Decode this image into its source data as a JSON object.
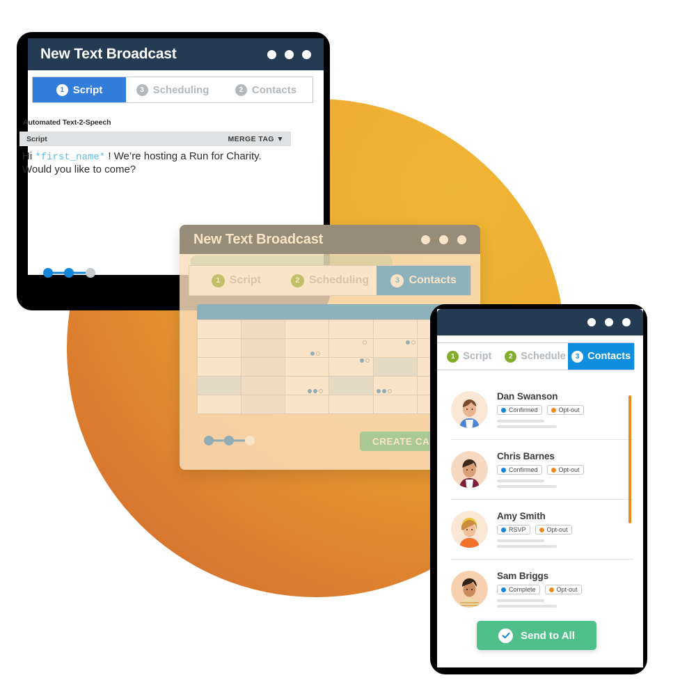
{
  "window1": {
    "title": "New Text Broadcast",
    "tabs": [
      {
        "num": "1",
        "label": "Script",
        "active": true
      },
      {
        "num": "3",
        "label": "Scheduling",
        "active": false
      },
      {
        "num": "2",
        "label": "Contacts",
        "active": false
      }
    ],
    "section_label": "Automated Text-2-Speech",
    "field_label": "Script",
    "merge_tag_label": "MERGE TAG",
    "merge_tag_caret": "▼",
    "script_prefix": "Hi ",
    "script_merge_field": "*first_name*",
    "script_suffix": " ! We’re hosting a Run for Charity. Would you like to come?",
    "steps": [
      "done",
      "done",
      "todo"
    ]
  },
  "window2": {
    "title": "New Text Broadcast",
    "tabs": [
      {
        "num": "1",
        "label": "Script",
        "active": false
      },
      {
        "num": "2",
        "label": "Scheduling",
        "active": false
      },
      {
        "num": "3",
        "label": "Contacts",
        "active": true
      }
    ],
    "primary_button": "CREATE CAMPAIGN",
    "steps": [
      "done",
      "done",
      "todo"
    ],
    "calendar": {
      "rows": 5,
      "cols": 6,
      "shaded_column": 1,
      "selected_cells": [
        [
          2,
          4
        ],
        [
          3,
          0
        ],
        [
          3,
          3
        ]
      ],
      "events": [
        {
          "row": 1,
          "col": 2,
          "filled": 1,
          "open": 1
        },
        {
          "row": 1,
          "col": 3,
          "filled": 0,
          "open": 1
        },
        {
          "row": 1,
          "col": 4,
          "filled": 1,
          "open": 1
        },
        {
          "row": 2,
          "col": 3,
          "filled": 1,
          "open": 1
        },
        {
          "row": 3,
          "col": 2,
          "filled": 2,
          "open": 1
        },
        {
          "row": 3,
          "col": 4,
          "filled": 2,
          "open": 1
        }
      ]
    }
  },
  "window3": {
    "tabs": [
      {
        "num": "1",
        "label": "Script",
        "active": false
      },
      {
        "num": "2",
        "label": "Schedule",
        "active": false
      },
      {
        "num": "3",
        "label": "Contacts",
        "active": true
      }
    ],
    "contacts": [
      {
        "name": "Dan Swanson",
        "status": "Confirmed",
        "optout": "Opt-out"
      },
      {
        "name": "Chris Barnes",
        "status": "Confirmed",
        "optout": "Opt-out"
      },
      {
        "name": "Amy Smith",
        "status": "RSVP",
        "optout": "Opt-out"
      },
      {
        "name": "Sam Briggs",
        "status": "Complete",
        "optout": "Opt-out"
      }
    ],
    "send_button": "Send to All"
  },
  "colors": {
    "navy": "#243b53",
    "blue": "#0f8ee0",
    "blue_alt": "#337ddb",
    "green": "#4fc08a",
    "green_num": "#82ad2a",
    "orange": "#ef8b1e",
    "circle_from": "#efb536",
    "circle_to": "#d06f2c"
  }
}
